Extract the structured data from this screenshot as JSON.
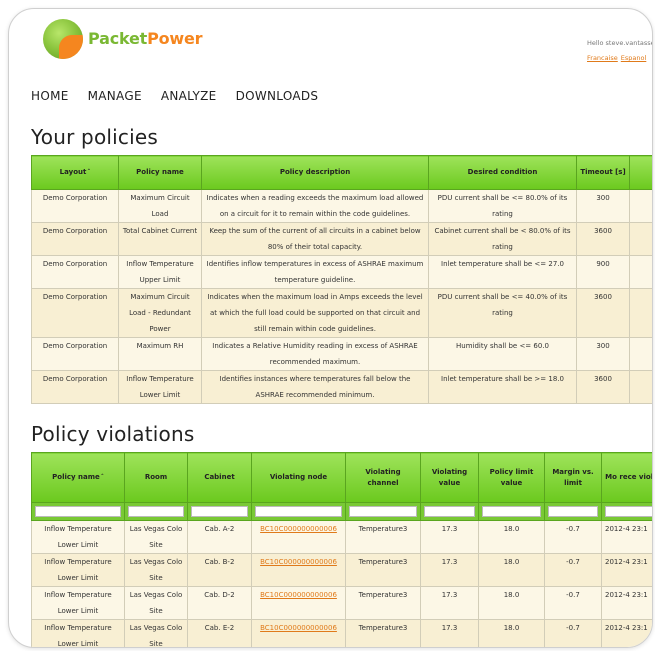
{
  "brand": {
    "logo_part1": "Packet",
    "logo_part2": "Power"
  },
  "user": {
    "greeting": "Hello steve.vantassel",
    "lang1": "Francaise",
    "lang2": "Espanol"
  },
  "nav": [
    "HOME",
    "MANAGE",
    "ANALYZE",
    "DOWNLOADS"
  ],
  "policies": {
    "title": "Your policies",
    "headers": [
      "Layout",
      "Policy name",
      "Policy description",
      "Desired condition",
      "Timeout [s]",
      ""
    ],
    "sort_arrow": "ˆ",
    "rows": [
      {
        "layout": "Demo Corporation",
        "name": "Maximum Circuit Load",
        "description": "Indicates when a reading exceeds the maximum load allowed on a circuit for it to remain within the code guidelines.",
        "condition": "PDU current shall be <= 80.0% of its rating",
        "timeout": "300"
      },
      {
        "layout": "Demo Corporation",
        "name": "Total Cabinet Current",
        "description": "Keep the sum of the current of all circuits in a cabinet below 80% of their total capacity.",
        "condition": "Cabinet current shall be < 80.0% of its rating",
        "timeout": "3600"
      },
      {
        "layout": "Demo Corporation",
        "name": "Inflow Temperature Upper Limit",
        "description": "Identifies inflow temperatures in excess of ASHRAE maximum temperature guideline.",
        "condition": "Inlet temperature shall be <= 27.0",
        "timeout": "900"
      },
      {
        "layout": "Demo Corporation",
        "name": "Maximum Circuit Load - Redundant Power",
        "description": "Indicates when the maximum load in Amps exceeds the level at which the full load could be supported on that circuit and still remain within code guidelines.",
        "condition": "PDU current shall be <= 40.0% of its rating",
        "timeout": "3600"
      },
      {
        "layout": "Demo Corporation",
        "name": "Maximum RH",
        "description": "Indicates a Relative Humidity reading in excess of ASHRAE recommended maximum.",
        "condition": "Humidity shall be <= 60.0",
        "timeout": "300"
      },
      {
        "layout": "Demo Corporation",
        "name": "Inflow Temperature Lower Limit",
        "description": "Identifies instances where temperatures fall below the ASHRAE recommended minimum.",
        "condition": "Inlet temperature shall be >= 18.0",
        "timeout": "3600"
      }
    ]
  },
  "violations": {
    "title": "Policy violations",
    "headers": [
      "Policy name",
      "Room",
      "Cabinet",
      "Violating node",
      "Violating channel",
      "Violating value",
      "Policy limit value",
      "Margin vs. limit",
      "Mo rece viola"
    ],
    "rows": [
      {
        "policy": "Inflow Temperature Lower Limit",
        "room": "Las Vegas Colo Site",
        "cabinet": "Cab. A-2",
        "node": "BC10C000000000006",
        "channel": "Temperature3",
        "value": "17.3",
        "limit": "18.0",
        "margin": "-0.7",
        "recent": "2012-4 23:1"
      },
      {
        "policy": "Inflow Temperature Lower Limit",
        "room": "Las Vegas Colo Site",
        "cabinet": "Cab. B-2",
        "node": "BC10C000000000006",
        "channel": "Temperature3",
        "value": "17.3",
        "limit": "18.0",
        "margin": "-0.7",
        "recent": "2012-4 23:1"
      },
      {
        "policy": "Inflow Temperature Lower Limit",
        "room": "Las Vegas Colo Site",
        "cabinet": "Cab. D-2",
        "node": "BC10C000000000006",
        "channel": "Temperature3",
        "value": "17.3",
        "limit": "18.0",
        "margin": "-0.7",
        "recent": "2012-4 23:1"
      },
      {
        "policy": "Inflow Temperature Lower Limit",
        "room": "Las Vegas Colo Site",
        "cabinet": "Cab. E-2",
        "node": "BC10C000000000006",
        "channel": "Temperature3",
        "value": "17.3",
        "limit": "18.0",
        "margin": "-0.7",
        "recent": "2012-4 23:1"
      }
    ]
  },
  "colors": {
    "header_green": "#7ac932",
    "row_cream": "#fcf7e6",
    "brand_orange": "#f5861f",
    "link_orange": "#e07a1a"
  }
}
